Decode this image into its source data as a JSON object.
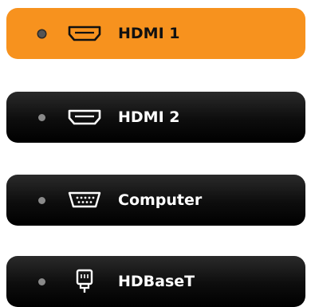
{
  "sources": [
    {
      "label": "HDMI 1",
      "icon": "hdmi-port-icon",
      "selected": true
    },
    {
      "label": "HDMI 2",
      "icon": "hdmi-port-icon",
      "selected": false
    },
    {
      "label": "Computer",
      "icon": "vga-port-icon",
      "selected": false
    },
    {
      "label": "HDBaseT",
      "icon": "ethernet-port-icon",
      "selected": false
    }
  ],
  "colors": {
    "active_background": "#f7921e",
    "inactive_background": "#000000",
    "active_text": "#111111",
    "inactive_text": "#ffffff"
  }
}
